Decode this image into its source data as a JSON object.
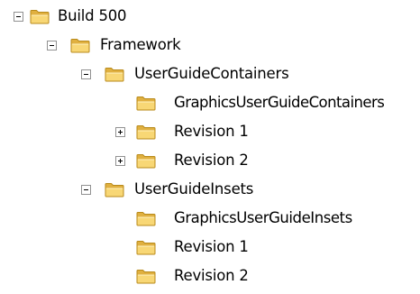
{
  "tree": {
    "root": {
      "label": "Build 500",
      "expanded": true,
      "icon": "folder-icon",
      "children": {
        "framework": {
          "label": "Framework",
          "expanded": true,
          "icon": "folder-icon",
          "children": {
            "user_guide_containers": {
              "label": "UserGuideContainers",
              "expanded": true,
              "icon": "folder-icon",
              "children": [
                {
                  "label": "GraphicsUserGuideContainers",
                  "expandable": false
                },
                {
                  "label": "Revision 1",
                  "expandable": true,
                  "expanded": false
                },
                {
                  "label": "Revision 2",
                  "expandable": true,
                  "expanded": false
                }
              ]
            },
            "user_guide_insets": {
              "label": "UserGuideInsets",
              "expanded": true,
              "icon": "folder-icon",
              "children": [
                {
                  "label": "GraphicsUserGuideInsets",
                  "expandable": false
                },
                {
                  "label": "Revision 1",
                  "expandable": false
                },
                {
                  "label": "Revision 2",
                  "expandable": false
                }
              ]
            }
          }
        }
      }
    }
  },
  "colors": {
    "background": "#ffffff",
    "toggle_border": "#919191",
    "folder_fill": "#f8d775",
    "folder_tab": "#e0b040",
    "folder_outline": "#b88a1a"
  }
}
